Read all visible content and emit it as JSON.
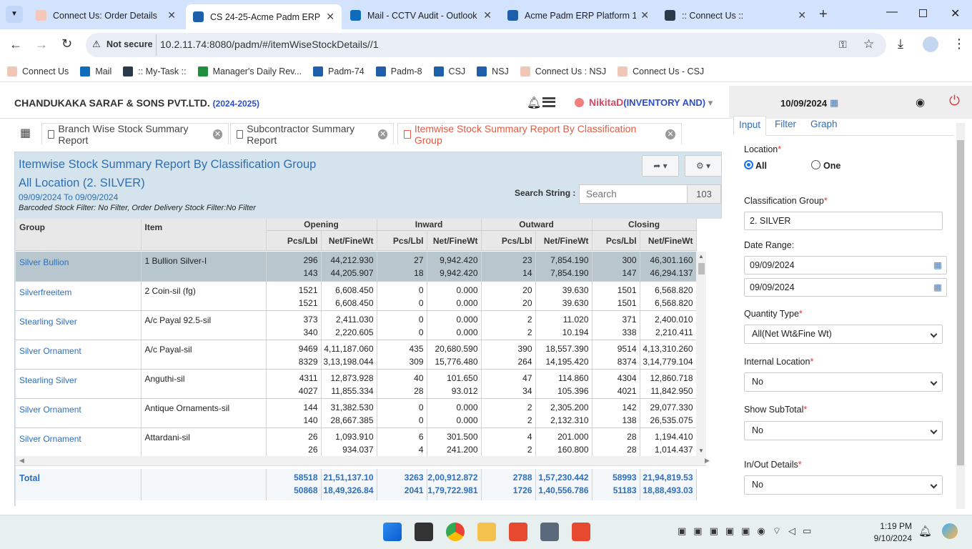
{
  "browser": {
    "tabs": [
      {
        "title": "Connect Us: Order Details",
        "active": false
      },
      {
        "title": "CS 24-25-Acme Padm ERP P",
        "active": true
      },
      {
        "title": "Mail - CCTV Audit - Outlook",
        "active": false
      },
      {
        "title": "Acme Padm ERP Platform 1.",
        "active": false
      },
      {
        "title": ":: Connect Us ::",
        "active": false
      }
    ],
    "security": "Not secure",
    "url": "10.2.11.74:8080/padm/#/itemWiseStockDetails//1",
    "bookmarks": [
      "Connect Us",
      "Mail",
      ":: My-Task ::",
      "Manager's Daily Rev...",
      "Padm-74",
      "Padm-8",
      "CSJ",
      "NSJ",
      "Connect Us : NSJ",
      "Connect Us - CSJ"
    ]
  },
  "header": {
    "company": "CHANDUKAKA SARAF & SONS PVT.LTD.",
    "year": "(2024-2025)",
    "user": "NikitaD",
    "role": "(INVENTORY AND)",
    "date": "10/09/2024"
  },
  "page_tabs": [
    {
      "label": "Branch Wise Stock Summary Report",
      "active": false
    },
    {
      "label": "Subcontractor Summary Report",
      "active": false
    },
    {
      "label": "Itemwise Stock Summary Report By Classification Group",
      "active": true
    }
  ],
  "report": {
    "title": "Itemwise Stock Summary Report By Classification Group",
    "subtitle": "All Location (2. SILVER)",
    "date_range": "09/09/2024 To 09/09/2024",
    "filter_note": "Barcoded Stock Filter: No Filter, Order Delivery Stock Filter:No Filter",
    "search_label": "Search String :",
    "search_placeholder": "Search",
    "count": "103",
    "col_group": "Group",
    "col_item": "Item",
    "groups": [
      "Opening",
      "Inward",
      "Outward",
      "Closing"
    ],
    "sub_pcs": "Pcs/Lbl",
    "sub_wt": "Net/FineWt",
    "rows": [
      {
        "group": "Silver Bullion",
        "item": "1 Bullion Silver-I",
        "v": [
          [
            "296",
            "44,212.930",
            "27",
            "9,942.420",
            "23",
            "7,854.190",
            "300",
            "46,301.160"
          ],
          [
            "143",
            "44,205.907",
            "18",
            "9,942.420",
            "14",
            "7,854.190",
            "147",
            "46,294.137"
          ]
        ]
      },
      {
        "group": "Silverfreeitem",
        "item": "2 Coin-sil (fg)",
        "v": [
          [
            "1521",
            "6,608.450",
            "0",
            "0.000",
            "20",
            "39.630",
            "1501",
            "6,568.820"
          ],
          [
            "1521",
            "6,608.450",
            "0",
            "0.000",
            "20",
            "39.630",
            "1501",
            "6,568.820"
          ]
        ]
      },
      {
        "group": "Stearling Silver",
        "item": "A/c Payal 92.5-sil",
        "v": [
          [
            "373",
            "2,411.030",
            "0",
            "0.000",
            "2",
            "11.020",
            "371",
            "2,400.010"
          ],
          [
            "340",
            "2,220.605",
            "0",
            "0.000",
            "2",
            "10.194",
            "338",
            "2,210.411"
          ]
        ]
      },
      {
        "group": "Silver Ornament",
        "item": "A/c Payal-sil",
        "v": [
          [
            "9469",
            "4,11,187.060",
            "435",
            "20,680.590",
            "390",
            "18,557.390",
            "9514",
            "4,13,310.260"
          ],
          [
            "8329",
            "3,13,198.044",
            "309",
            "15,776.480",
            "264",
            "14,195.420",
            "8374",
            "3,14,779.104"
          ]
        ]
      },
      {
        "group": "Stearling Silver",
        "item": "Anguthi-sil",
        "v": [
          [
            "4311",
            "12,873.928",
            "40",
            "101.650",
            "47",
            "114.860",
            "4304",
            "12,860.718"
          ],
          [
            "4027",
            "11,855.334",
            "28",
            "93.012",
            "34",
            "105.396",
            "4021",
            "11,842.950"
          ]
        ]
      },
      {
        "group": "Silver Ornament",
        "item": "Antique Ornaments-sil",
        "v": [
          [
            "144",
            "31,382.530",
            "0",
            "0.000",
            "2",
            "2,305.200",
            "142",
            "29,077.330"
          ],
          [
            "140",
            "28,667.385",
            "0",
            "0.000",
            "2",
            "2,132.310",
            "138",
            "26,535.075"
          ]
        ]
      },
      {
        "group": "Silver Ornament",
        "item": "Attardani-sil",
        "v": [
          [
            "26",
            "1,093.910",
            "6",
            "301.500",
            "4",
            "201.000",
            "28",
            "1,194.410"
          ],
          [
            "26",
            "934.037",
            "4",
            "241.200",
            "2",
            "160.800",
            "28",
            "1,014.437"
          ]
        ]
      }
    ],
    "total_label": "Total",
    "total": [
      [
        "58518",
        "21,51,137.10",
        "3263",
        "2,00,912.872",
        "2788",
        "1,57,230.442",
        "58993",
        "21,94,819.53"
      ],
      [
        "50868",
        "18,49,326.84",
        "2041",
        "1,79,722.981",
        "1726",
        "1,40,556.786",
        "51183",
        "18,88,493.03"
      ]
    ]
  },
  "right_panel": {
    "tabs": [
      "Input",
      "Filter",
      "Graph"
    ],
    "location_label": "Location",
    "location_all": "All",
    "location_one": "One",
    "class_label": "Classification Group",
    "class_value": "2. SILVER",
    "date_label": "Date Range:",
    "date_from": "09/09/2024",
    "date_to": "09/09/2024",
    "qty_label": "Quantity Type",
    "qty_value": "All(Net Wt&Fine Wt)",
    "internal_label": "Internal Location",
    "internal_value": "No",
    "subtotal_label": "Show SubTotal",
    "subtotal_value": "No",
    "inout_label": "In/Out Details",
    "inout_value": "No"
  },
  "taskbar": {
    "time": "1:19 PM",
    "date": "9/10/2024"
  }
}
